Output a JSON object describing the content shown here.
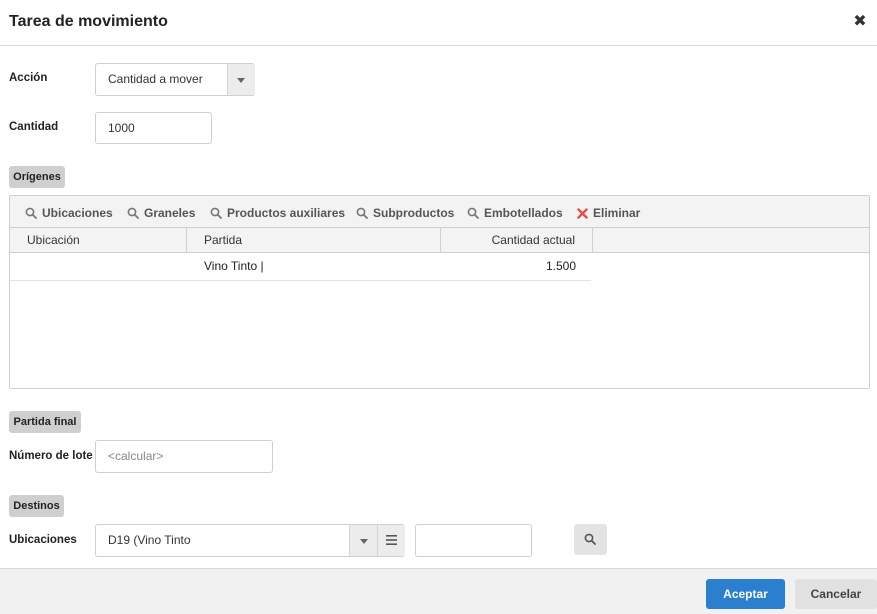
{
  "dialog": {
    "title": "Tarea de movimiento",
    "close_icon": "close-icon"
  },
  "form": {
    "accion": {
      "label": "Acción",
      "value": "Cantidad a mover"
    },
    "cantidad": {
      "label": "Cantidad",
      "value": "1000"
    }
  },
  "origenes": {
    "section_label": "Orígenes",
    "toolbar": [
      {
        "icon": "search-icon",
        "label": "Ubicaciones"
      },
      {
        "icon": "search-icon",
        "label": "Graneles"
      },
      {
        "icon": "search-icon",
        "label": "Productos auxiliares"
      },
      {
        "icon": "search-icon",
        "label": "Subproductos"
      },
      {
        "icon": "search-icon",
        "label": "Embotellados"
      },
      {
        "icon": "delete-x-icon",
        "label": "Eliminar",
        "color": "#e05050"
      }
    ],
    "columns": [
      "Ubicación",
      "Partida",
      "Cantidad actual"
    ],
    "rows": [
      {
        "ubicacion": "",
        "partida": "Vino Tinto |",
        "cantidad": "1.500"
      }
    ]
  },
  "partida_final": {
    "section_label": "Partida final",
    "numero_lote": {
      "label": "Número de lote",
      "placeholder": "<calcular>"
    }
  },
  "destinos": {
    "section_label": "Destinos",
    "ubicaciones": {
      "label": "Ubicaciones",
      "value": "D19 (Vino Tinto",
      "extra_value": ""
    }
  },
  "footer": {
    "accept_label": "Aceptar",
    "cancel_label": "Cancelar"
  },
  "colors": {
    "primary": "#2a7fcf",
    "danger": "#e05050",
    "badge_bg": "#cfcfcf"
  }
}
